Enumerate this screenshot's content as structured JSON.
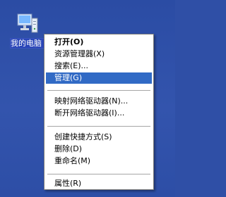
{
  "desktop": {
    "icon": {
      "name": "my-computer-icon",
      "label": "我的电脑"
    }
  },
  "context_menu": {
    "items": [
      {
        "label": "打开(O)"
      },
      {
        "label": "资源管理器(X)"
      },
      {
        "label": "搜索(E)..."
      },
      {
        "label": "管理(G)"
      },
      {
        "label": "映射网络驱动器(N)..."
      },
      {
        "label": "断开网络驱动器(I)..."
      },
      {
        "label": "创建快捷方式(S)"
      },
      {
        "label": "删除(D)"
      },
      {
        "label": "重命名(M)"
      },
      {
        "label": "属性(R)"
      }
    ]
  },
  "colors": {
    "desktop_blue": "#2f4fa6",
    "selection_blue": "#316ac5",
    "menu_background": "#ffffff"
  }
}
